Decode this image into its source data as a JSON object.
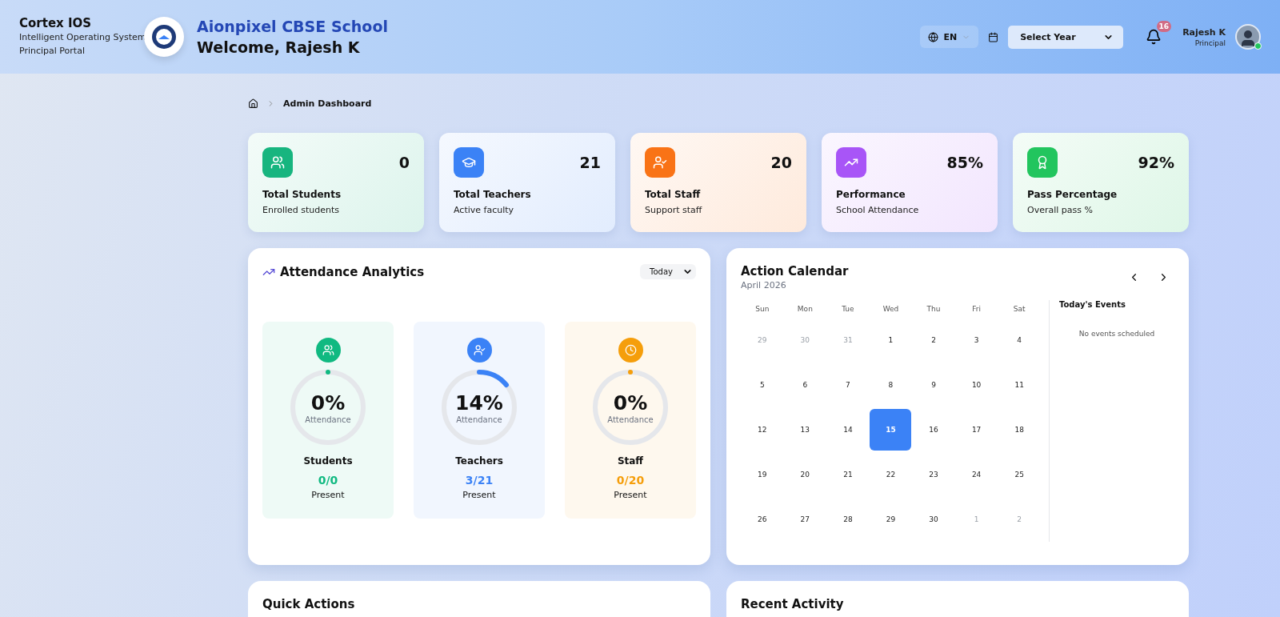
{
  "header": {
    "brand": "Cortex IOS",
    "tagline": "Intelligent Operating System",
    "portal": "Principal Portal",
    "school": "Aionpixel CBSE School",
    "welcome": "Welcome, Rajesh K",
    "language": "EN",
    "year_placeholder": "Select Year",
    "notification_count": "16",
    "user_name": "Rajesh K",
    "user_role": "Principal",
    "online": true
  },
  "breadcrumb": {
    "current": "Admin Dashboard"
  },
  "stats": [
    {
      "value": "0",
      "title": "Total Students",
      "subtitle": "Enrolled students",
      "color": "#17b57f"
    },
    {
      "value": "21",
      "title": "Total Teachers",
      "subtitle": "Active faculty",
      "color": "#3b82f6"
    },
    {
      "value": "20",
      "title": "Total Staff",
      "subtitle": "Support staff",
      "color": "#f97316"
    },
    {
      "value": "85%",
      "title": "Performance",
      "subtitle": "School Attendance",
      "color": "#a855f7"
    },
    {
      "value": "92%",
      "title": "Pass Percentage",
      "subtitle": "Overall pass %",
      "color": "#22c55e"
    }
  ],
  "attendance": {
    "title": "Attendance Analytics",
    "period": "Today",
    "groups": [
      {
        "percent": "0%",
        "caption": "Attendance",
        "name": "Students",
        "ratio": "0/0",
        "status": "Present",
        "level": 0,
        "color": "#10b981"
      },
      {
        "percent": "14%",
        "caption": "Attendance",
        "name": "Teachers",
        "ratio": "3/21",
        "status": "Present",
        "level": 0.14,
        "color": "#3b82f6"
      },
      {
        "percent": "0%",
        "caption": "Attendance",
        "name": "Staff",
        "ratio": "0/20",
        "status": "Present",
        "level": 0,
        "color": "#f59e0b"
      }
    ]
  },
  "calendar": {
    "title": "Action Calendar",
    "month": "April 2026",
    "weekdays": [
      "Sun",
      "Mon",
      "Tue",
      "Wed",
      "Thu",
      "Fri",
      "Sat"
    ],
    "days": [
      {
        "label": "29",
        "muted": true,
        "selected": false
      },
      {
        "label": "30",
        "muted": true,
        "selected": false
      },
      {
        "label": "31",
        "muted": true,
        "selected": false
      },
      {
        "label": "1",
        "muted": false,
        "selected": false
      },
      {
        "label": "2",
        "muted": false,
        "selected": false
      },
      {
        "label": "3",
        "muted": false,
        "selected": false
      },
      {
        "label": "4",
        "muted": false,
        "selected": false
      },
      {
        "label": "5",
        "muted": false,
        "selected": false
      },
      {
        "label": "6",
        "muted": false,
        "selected": false
      },
      {
        "label": "7",
        "muted": false,
        "selected": false
      },
      {
        "label": "8",
        "muted": false,
        "selected": false
      },
      {
        "label": "9",
        "muted": false,
        "selected": false
      },
      {
        "label": "10",
        "muted": false,
        "selected": false
      },
      {
        "label": "11",
        "muted": false,
        "selected": false
      },
      {
        "label": "12",
        "muted": false,
        "selected": false
      },
      {
        "label": "13",
        "muted": false,
        "selected": false
      },
      {
        "label": "14",
        "muted": false,
        "selected": false
      },
      {
        "label": "15",
        "muted": false,
        "selected": true
      },
      {
        "label": "16",
        "muted": false,
        "selected": false
      },
      {
        "label": "17",
        "muted": false,
        "selected": false
      },
      {
        "label": "18",
        "muted": false,
        "selected": false
      },
      {
        "label": "19",
        "muted": false,
        "selected": false
      },
      {
        "label": "20",
        "muted": false,
        "selected": false
      },
      {
        "label": "21",
        "muted": false,
        "selected": false
      },
      {
        "label": "22",
        "muted": false,
        "selected": false
      },
      {
        "label": "23",
        "muted": false,
        "selected": false
      },
      {
        "label": "24",
        "muted": false,
        "selected": false
      },
      {
        "label": "25",
        "muted": false,
        "selected": false
      },
      {
        "label": "26",
        "muted": false,
        "selected": false
      },
      {
        "label": "27",
        "muted": false,
        "selected": false
      },
      {
        "label": "28",
        "muted": false,
        "selected": false
      },
      {
        "label": "29",
        "muted": false,
        "selected": false
      },
      {
        "label": "30",
        "muted": false,
        "selected": false
      },
      {
        "label": "1",
        "muted": true,
        "selected": false
      },
      {
        "label": "2",
        "muted": true,
        "selected": false
      }
    ],
    "events_title": "Today's Events",
    "events_empty": "No events scheduled"
  },
  "bottom_panels": [
    {
      "title": "Quick Actions"
    },
    {
      "title": "Recent Activity"
    }
  ]
}
